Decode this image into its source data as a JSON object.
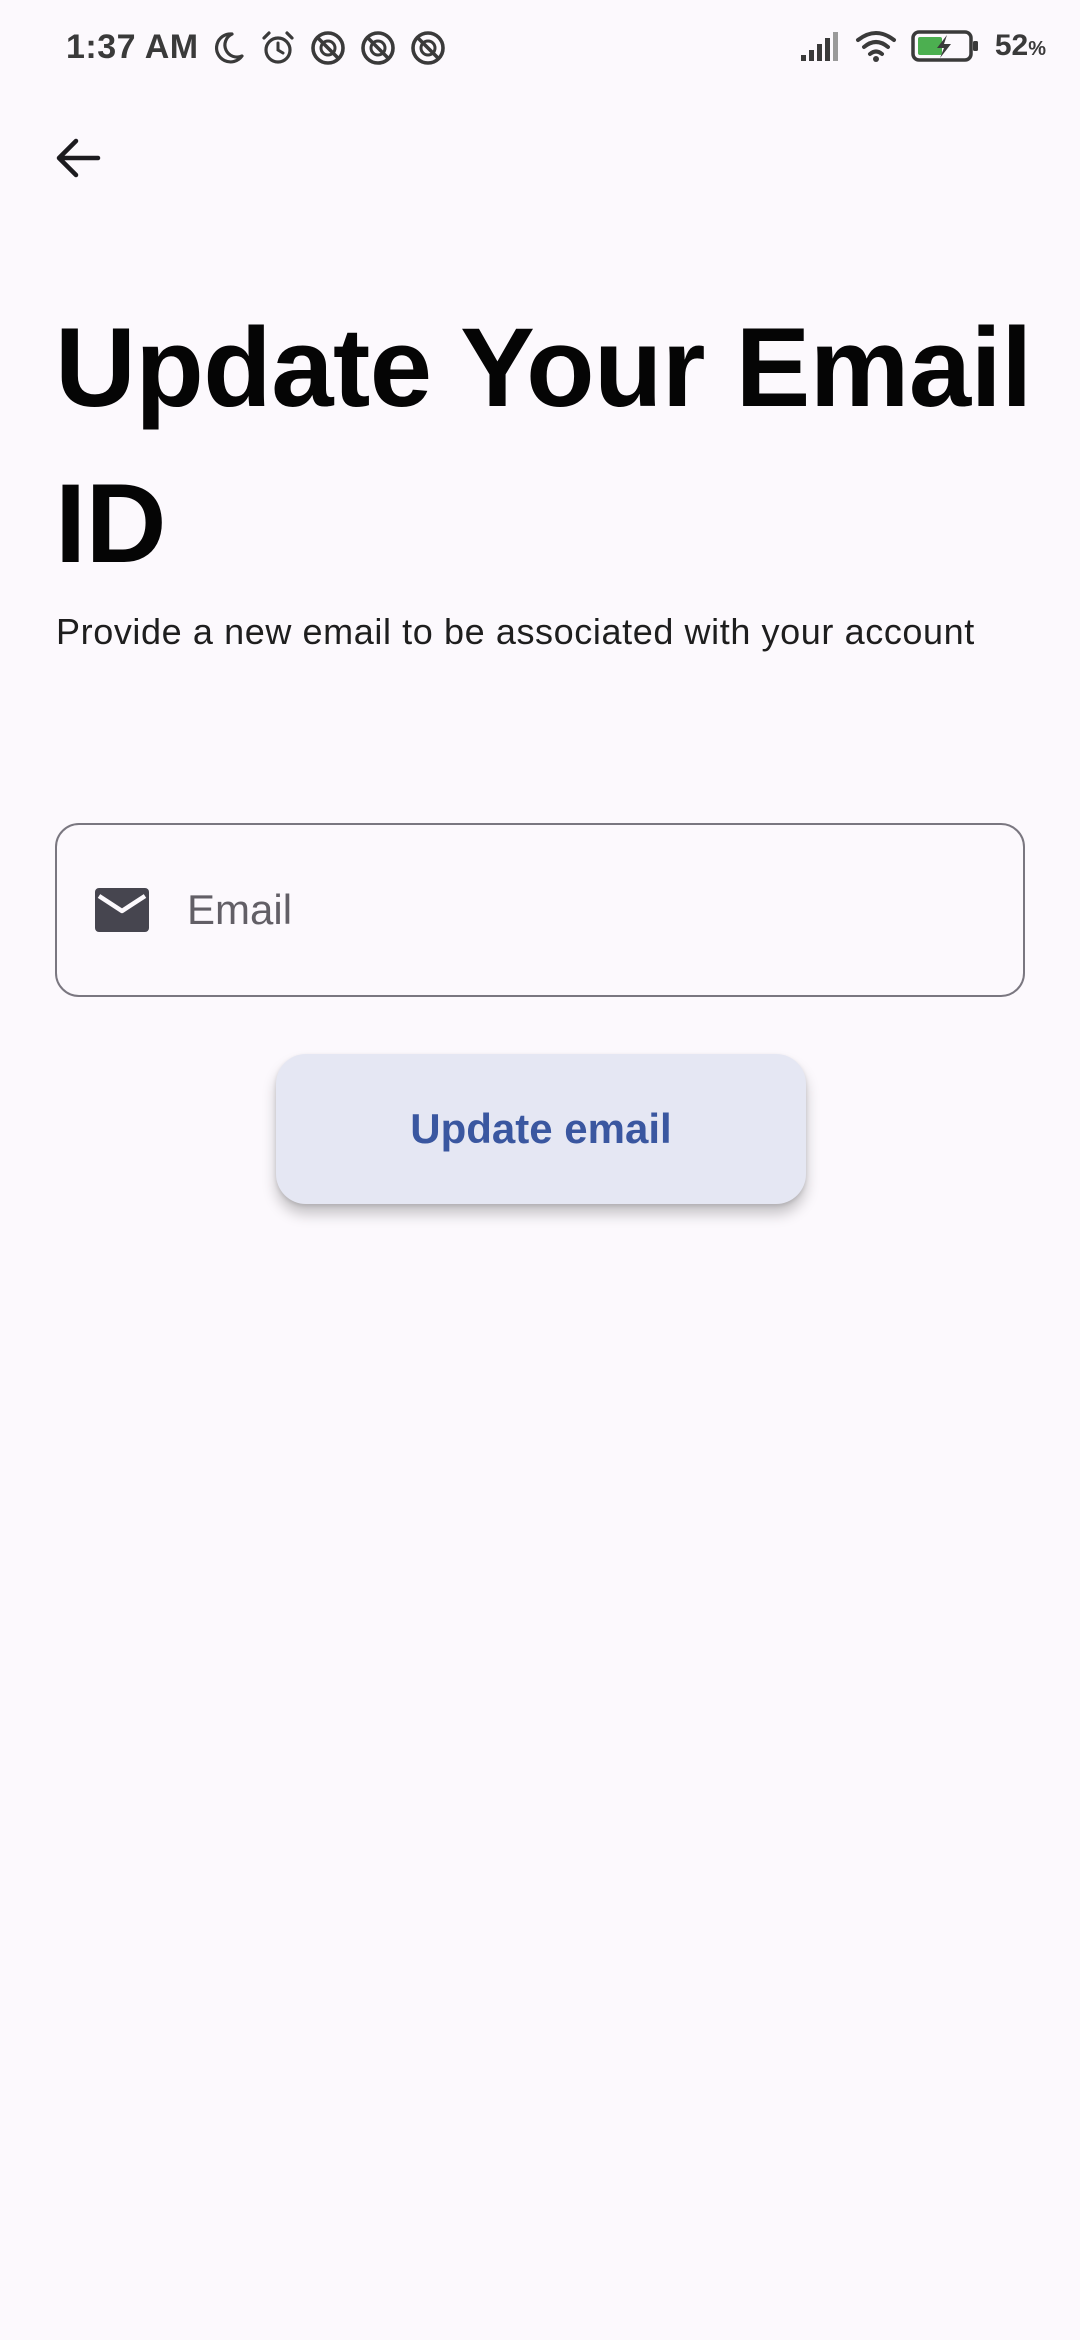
{
  "status_bar": {
    "time": "1:37 AM",
    "battery_percent": "52",
    "battery_unit": "%",
    "icons_left": [
      "moon-icon",
      "alarm-icon",
      "blocked-icon",
      "blocked-icon",
      "blocked-icon"
    ],
    "icons_right": [
      "signal-icon",
      "wifi-icon",
      "battery-charging-icon"
    ]
  },
  "header": {
    "back_icon": "arrow-left-icon"
  },
  "main": {
    "title": "Update Your Email ID",
    "subtitle": "Provide a new email to be associated with your account",
    "email_field": {
      "icon": "mail-icon",
      "placeholder": "Email",
      "value": ""
    },
    "update_button_label": "Update email"
  },
  "colors": {
    "background": "#fcf9fd",
    "button_background": "#e5e7f3",
    "button_text": "#3a57a0",
    "field_border": "#7a7780",
    "icon_dark": "#46454f"
  }
}
